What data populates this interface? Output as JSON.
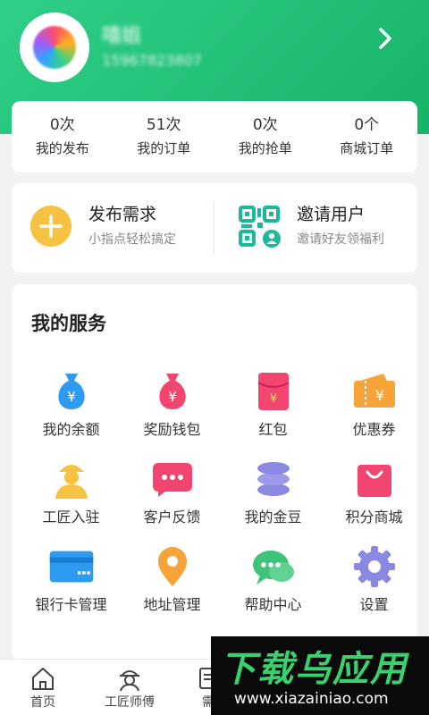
{
  "profile": {
    "name": "嘻姐",
    "phone": "15967823807"
  },
  "stats": [
    {
      "count": "0次",
      "label": "我的发布"
    },
    {
      "count": "51次",
      "label": "我的订单"
    },
    {
      "count": "0次",
      "label": "我的抢单"
    },
    {
      "count": "0个",
      "label": "商城订单"
    }
  ],
  "actions": {
    "publish": {
      "title": "发布需求",
      "subtitle": "小指点轻松搞定"
    },
    "invite": {
      "title": "邀请用户",
      "subtitle": "邀请好友领福利"
    }
  },
  "services": {
    "title": "我的服务",
    "items": [
      {
        "label": "我的余额",
        "icon": "money-bag-icon"
      },
      {
        "label": "奖励钱包",
        "icon": "reward-bag-icon"
      },
      {
        "label": "红包",
        "icon": "red-envelope-icon"
      },
      {
        "label": "优惠券",
        "icon": "coupon-icon"
      },
      {
        "label": "工匠入驻",
        "icon": "worker-icon"
      },
      {
        "label": "客户反馈",
        "icon": "chat-bubble-icon"
      },
      {
        "label": "我的金豆",
        "icon": "coin-stack-icon"
      },
      {
        "label": "积分商城",
        "icon": "shopping-bag-icon"
      },
      {
        "label": "银行卡管理",
        "icon": "bank-card-icon"
      },
      {
        "label": "地址管理",
        "icon": "location-pin-icon"
      },
      {
        "label": "帮助中心",
        "icon": "help-chat-icon"
      },
      {
        "label": "设置",
        "icon": "gear-icon"
      }
    ]
  },
  "tabbar": [
    {
      "label": "首页",
      "icon": "home-icon"
    },
    {
      "label": "工匠师傅",
      "icon": "worker-helmet-icon"
    },
    {
      "label": "需",
      "icon": "document-icon"
    }
  ],
  "watermark": {
    "main": "下载乌应用",
    "url": "www.xiazainiao.com"
  },
  "colors": {
    "brand_green": "#1bbd73",
    "yellow": "#f5c242",
    "blue": "#2f9bf0",
    "pink": "#f24670",
    "purple": "#8a88e0",
    "orange": "#f6a33a"
  }
}
